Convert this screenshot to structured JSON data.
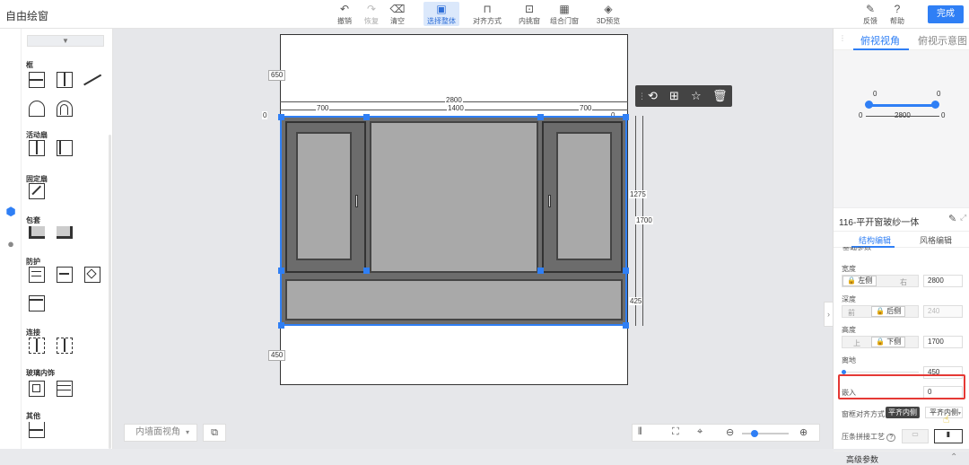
{
  "app_title": "自由绘窗",
  "toolbar": {
    "undo": "撤销",
    "redo": "恢复",
    "clear": "清空",
    "select_all": "选择整体",
    "align": "对齐方式",
    "inner_frame": "内挑窗",
    "combo_door": "组合门窗",
    "preview_3d": "3D预览",
    "feedback": "反馈",
    "help": "帮助",
    "done": "完成"
  },
  "left_panel": {
    "dropdown": "▼",
    "sections": {
      "frame": "框",
      "active_sash": "活动扇",
      "fixed_sash": "固定扇",
      "wrap": "包套",
      "guard": "防护",
      "connect": "连接",
      "glass_decor": "玻璃内饰",
      "other": "其他"
    }
  },
  "canvas": {
    "dims": {
      "top_height": "650",
      "bottom_height": "450",
      "total_width": "2800",
      "seg_left": "700",
      "seg_mid": "1400",
      "seg_right": "700",
      "left_zero": "0",
      "right_zero": "0",
      "right_1275": "1275",
      "right_1700": "1700",
      "right_425": "425"
    },
    "view_select": "内墙面视角"
  },
  "right_panel": {
    "tabs": [
      "俯视视角",
      "俯视示意图"
    ],
    "preview_vals": {
      "left": "0",
      "mid": "2800",
      "right": "0",
      "top_left": "0",
      "top_right": "0"
    },
    "product_name": "116-平开窗玻纱一体",
    "sub_tabs": [
      "结构编辑",
      "风格编辑"
    ],
    "partial_heading": "基础参数",
    "width": {
      "label": "宽度",
      "left": "左侧",
      "right": "右",
      "value": "2800"
    },
    "depth": {
      "label": "深度",
      "front": "前",
      "back": "后侧",
      "value": "240"
    },
    "height": {
      "label": "高度",
      "up": "上",
      "down": "下侧",
      "value": "1700"
    },
    "ground": {
      "label": "离地",
      "value": "450"
    },
    "embed": {
      "label": "嵌入",
      "value": "0"
    },
    "frame_align": {
      "label": "窗框对齐方式",
      "selected": "平齐内侧",
      "dropdown": "平齐内侧"
    },
    "bead_joint": {
      "label": "压条拼接工艺"
    },
    "advanced": "高级参数"
  }
}
